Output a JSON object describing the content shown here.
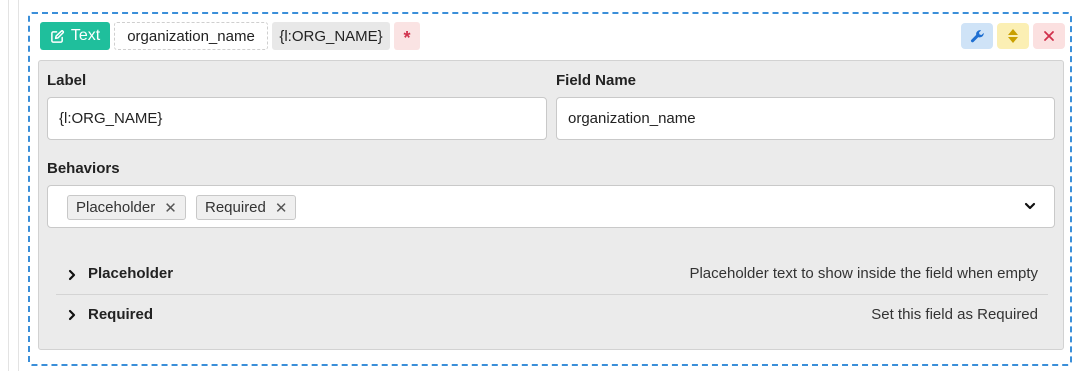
{
  "field": {
    "type_label": "Text",
    "type_icon": "edit-icon",
    "name_chip": "organization_name",
    "label_chip": "{l:ORG_NAME}",
    "required_marker": "*",
    "actions": [
      {
        "icon": "wrench-icon",
        "color": "#cfe3f7"
      },
      {
        "icon": "sort-icon",
        "color": "#fbefb4"
      },
      {
        "icon": "close-icon",
        "color": "#fbe0e0"
      }
    ]
  },
  "form": {
    "label_title": "Label",
    "label_value": "{l:ORG_NAME}",
    "field_name_title": "Field Name",
    "field_name_value": "organization_name",
    "behaviors_title": "Behaviors",
    "selected_behaviors": [
      "Placeholder",
      "Required"
    ],
    "tag_remove_glyph": "✕"
  },
  "behaviors": [
    {
      "title": "Placeholder",
      "description": "Placeholder text to show inside the field when empty"
    },
    {
      "title": "Required",
      "description": "Set this field as Required"
    }
  ],
  "colors": {
    "accent_teal": "#1fbf9c",
    "dashed_border": "#3b8fd9",
    "required_red": "#d0304b",
    "wrench_blue": "#1f6fd1",
    "sort_gold": "#c9a000"
  }
}
